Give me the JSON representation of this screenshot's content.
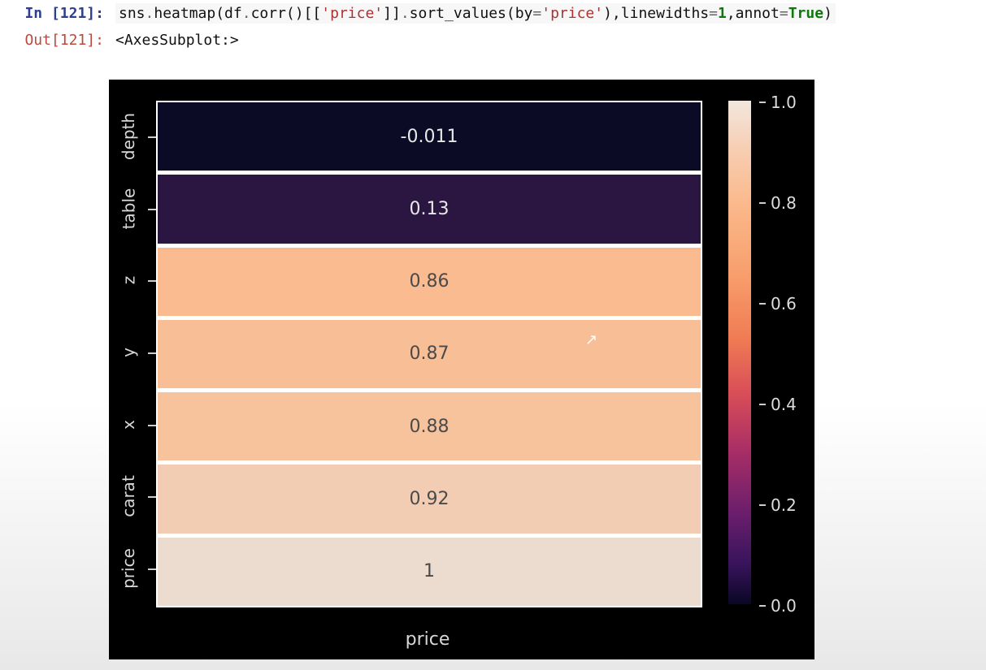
{
  "cell": {
    "in_prompt": "In [121]:",
    "out_prompt": "Out[121]:",
    "code_tokens": [
      {
        "t": "sns",
        "c": "tok-call"
      },
      {
        "t": ".",
        "c": "tok-op"
      },
      {
        "t": "heatmap",
        "c": "tok-call"
      },
      {
        "t": "(df",
        "c": "tok-call"
      },
      {
        "t": ".",
        "c": "tok-op"
      },
      {
        "t": "corr()[[",
        "c": "tok-call"
      },
      {
        "t": "'price'",
        "c": "tok-str"
      },
      {
        "t": "]]",
        "c": "tok-call"
      },
      {
        "t": ".",
        "c": "tok-op"
      },
      {
        "t": "sort_values(by",
        "c": "tok-call"
      },
      {
        "t": "=",
        "c": "tok-op"
      },
      {
        "t": "'price'",
        "c": "tok-str"
      },
      {
        "t": "),linewidths",
        "c": "tok-call"
      },
      {
        "t": "=",
        "c": "tok-op"
      },
      {
        "t": "1",
        "c": "tok-kw"
      },
      {
        "t": ",annot",
        "c": "tok-call"
      },
      {
        "t": "=",
        "c": "tok-op"
      },
      {
        "t": "True",
        "c": "tok-kw"
      },
      {
        "t": ")",
        "c": "tok-call"
      }
    ],
    "output_repr": "<AxesSubplot:>"
  },
  "chart_data": {
    "type": "heatmap",
    "title": "",
    "xlabel": "price",
    "ylabel": "",
    "x_categories": [
      "price"
    ],
    "y_categories": [
      "depth",
      "table",
      "z",
      "y",
      "x",
      "carat",
      "price"
    ],
    "values": [
      [
        -0.011
      ],
      [
        0.13
      ],
      [
        0.86
      ],
      [
        0.87
      ],
      [
        0.88
      ],
      [
        0.92
      ],
      [
        1
      ]
    ],
    "annotations": [
      "-0.011",
      "0.13",
      "0.86",
      "0.87",
      "0.88",
      "0.92",
      "1"
    ],
    "cell_colors": [
      "#0b0b25",
      "#2a1640",
      "#f9bb8f",
      "#f8bf96",
      "#f7c39d",
      "#f2cdb4",
      "#ecdbcf"
    ],
    "annot_colors": [
      "#e8e8e8",
      "#e8e8e8",
      "#4a4a4a",
      "#4a4a4a",
      "#4a4a4a",
      "#4a4a4a",
      "#4a4a4a"
    ],
    "colorbar": {
      "vmin": 0.0,
      "vmax": 1.0,
      "ticks": [
        0.0,
        0.2,
        0.4,
        0.6,
        0.8,
        1.0
      ],
      "tick_labels": [
        "0.0",
        "0.2",
        "0.4",
        "0.6",
        "0.8",
        "1.0"
      ],
      "gradient_stops": [
        {
          "at": 0.0,
          "c": "#f2e7dd"
        },
        {
          "at": 0.1,
          "c": "#f7cdb1"
        },
        {
          "at": 0.2,
          "c": "#faba8d"
        },
        {
          "at": 0.35,
          "c": "#f89d6b"
        },
        {
          "at": 0.47,
          "c": "#f07c54"
        },
        {
          "at": 0.58,
          "c": "#d94e57"
        },
        {
          "at": 0.7,
          "c": "#a62d66"
        },
        {
          "at": 0.82,
          "c": "#6a1e6c"
        },
        {
          "at": 0.92,
          "c": "#38145c"
        },
        {
          "at": 1.0,
          "c": "#0a0724"
        }
      ]
    }
  },
  "cursor": {
    "glyph": "↖"
  }
}
